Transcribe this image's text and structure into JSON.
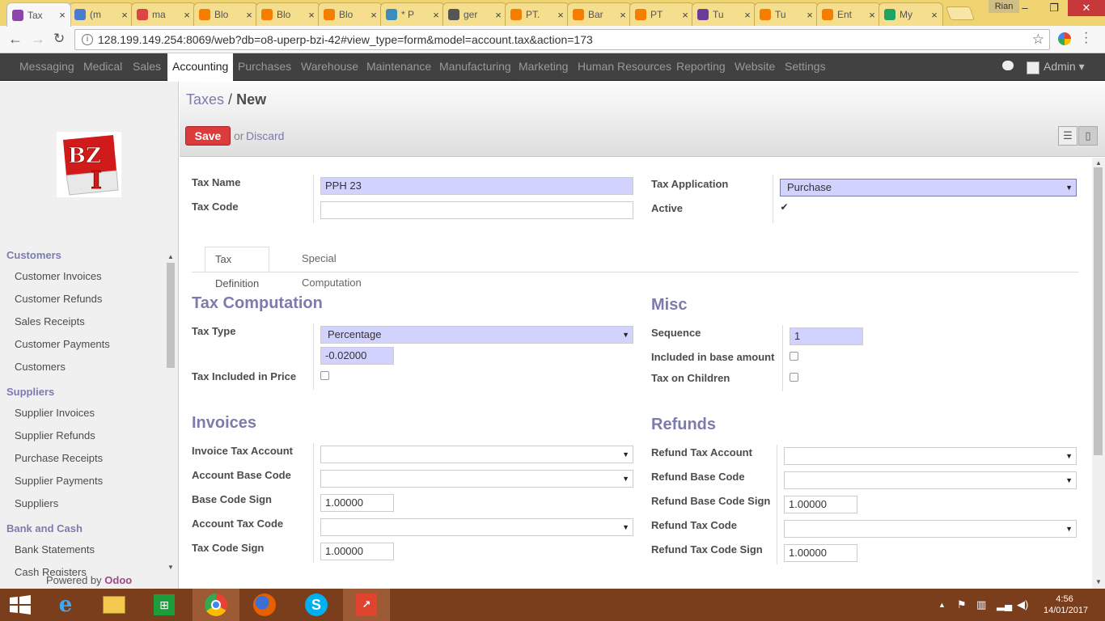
{
  "browser": {
    "tabs": [
      {
        "title": "Tax",
        "color": "#8e44ad",
        "active": true
      },
      {
        "title": "(m",
        "color": "#4a7bd1"
      },
      {
        "title": "ma",
        "color": "#d44"
      },
      {
        "title": "Blo",
        "color": "#f57d00"
      },
      {
        "title": "Blo",
        "color": "#f57d00"
      },
      {
        "title": "Blo",
        "color": "#f57d00"
      },
      {
        "title": "* P",
        "color": "#3c8dbc"
      },
      {
        "title": "ger",
        "color": "#555"
      },
      {
        "title": "PT.",
        "color": "#f57d00"
      },
      {
        "title": "Bar",
        "color": "#f57d00"
      },
      {
        "title": "PT",
        "color": "#f57d00"
      },
      {
        "title": "Tu",
        "color": "#6a3d9a"
      },
      {
        "title": "Tu",
        "color": "#f57d00"
      },
      {
        "title": "Ent",
        "color": "#f57d00"
      },
      {
        "title": "My",
        "color": "#1fa463"
      }
    ],
    "tab_close": "×",
    "profile": "Rian",
    "url": "128.199.149.254:8069/web?db=o8-uperp-bzi-42#view_type=form&model=account.tax&action=173"
  },
  "topnav": {
    "items": [
      "Messaging",
      "Medical",
      "Sales",
      "Accounting",
      "Purchases",
      "Warehouse",
      "Maintenance",
      "Manufacturing",
      "Marketing",
      "Human Resources",
      "Reporting",
      "Website",
      "Settings"
    ],
    "active": "Accounting",
    "user": "Admin"
  },
  "sidebar": {
    "sections": [
      {
        "title": "Customers",
        "items": [
          "Customer Invoices",
          "Customer Refunds",
          "Sales Receipts",
          "Customer Payments",
          "Customers"
        ]
      },
      {
        "title": "Suppliers",
        "items": [
          "Supplier Invoices",
          "Supplier Refunds",
          "Purchase Receipts",
          "Supplier Payments",
          "Suppliers"
        ]
      },
      {
        "title": "Bank and Cash",
        "items": [
          "Bank Statements",
          "Cash Registers"
        ]
      }
    ],
    "powered_by": "Powered by",
    "powered_brand": "Odoo"
  },
  "breadcrumb": {
    "parent": "Taxes",
    "sep": "/",
    "current": "New"
  },
  "actions": {
    "save": "Save",
    "or": "or",
    "discard": "Discard"
  },
  "form": {
    "tax_name_label": "Tax Name",
    "tax_name": "PPH 23",
    "tax_code_label": "Tax Code",
    "tax_code": "",
    "tax_application_label": "Tax Application",
    "tax_application": "Purchase",
    "active_label": "Active",
    "active": true,
    "tabs": [
      "Tax Definition",
      "Special Computation"
    ],
    "tax_computation_title": "Tax Computation",
    "tax_type_label": "Tax Type",
    "tax_type": "Percentage",
    "amount": "-0.02000",
    "tax_included_label": "Tax Included in Price",
    "misc_title": "Misc",
    "sequence_label": "Sequence",
    "sequence": "1",
    "included_base_label": "Included in base amount",
    "tax_on_children_label": "Tax on Children",
    "invoices_title": "Invoices",
    "invoice_tax_account_label": "Invoice Tax Account",
    "account_base_code_label": "Account Base Code",
    "base_code_sign_label": "Base Code Sign",
    "base_code_sign": "1.00000",
    "account_tax_code_label": "Account Tax Code",
    "tax_code_sign_label": "Tax Code Sign",
    "tax_code_sign": "1.00000",
    "refunds_title": "Refunds",
    "refund_tax_account_label": "Refund Tax Account",
    "refund_base_code_label": "Refund Base Code",
    "refund_base_code_sign_label": "Refund Base Code Sign",
    "refund_base_code_sign": "1.00000",
    "refund_tax_code_label": "Refund Tax Code",
    "refund_tax_code_sign_label": "Refund Tax Code Sign",
    "refund_tax_code_sign": "1.00000"
  },
  "taskbar": {
    "time": "4:56",
    "date": "14/01/2017"
  }
}
